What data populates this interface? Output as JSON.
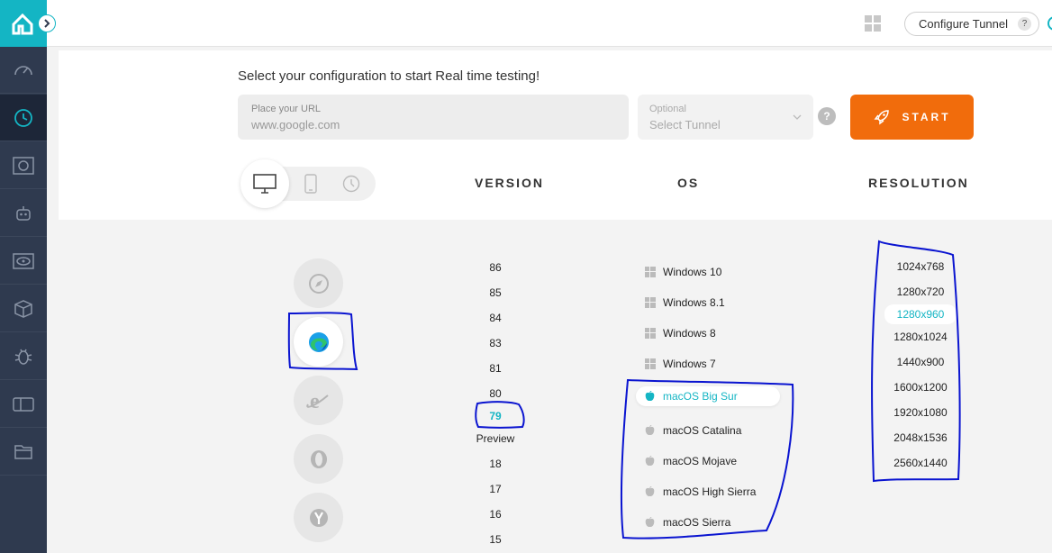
{
  "header": {
    "configure_tunnel": "Configure Tunnel",
    "help": "?"
  },
  "sidebar": {
    "items": [
      "dashboard-icon",
      "realtime-icon",
      "screenshot-icon",
      "automation-icon",
      "visual-icon",
      "app-icon",
      "bug-icon",
      "responsive-icon",
      "files-icon"
    ]
  },
  "config": {
    "headline": "Select your configuration to start Real time testing!",
    "url_label": "Place your URL",
    "url_placeholder": "www.google.com",
    "tunnel_label": "Optional",
    "tunnel_placeholder": "Select Tunnel",
    "help": "?",
    "start_label": "START"
  },
  "columns": {
    "version": "VERSION",
    "os": "OS",
    "resolution": "RESOLUTION"
  },
  "browsers": [
    "safari",
    "edge",
    "ie",
    "opera",
    "yandex"
  ],
  "selected_browser": "edge",
  "versions": [
    "86",
    "85",
    "84",
    "83",
    "81",
    "80",
    "79",
    "Preview",
    "18",
    "17",
    "16",
    "15"
  ],
  "selected_version": "79",
  "os_list": [
    {
      "name": "Windows 10",
      "type": "windows"
    },
    {
      "name": "Windows 8.1",
      "type": "windows"
    },
    {
      "name": "Windows 8",
      "type": "windows"
    },
    {
      "name": "Windows 7",
      "type": "windows"
    },
    {
      "name": "macOS Big Sur",
      "type": "apple"
    },
    {
      "name": "macOS Catalina",
      "type": "apple"
    },
    {
      "name": "macOS Mojave",
      "type": "apple"
    },
    {
      "name": "macOS High Sierra",
      "type": "apple"
    },
    {
      "name": "macOS Sierra",
      "type": "apple"
    }
  ],
  "selected_os": "macOS Big Sur",
  "resolutions": [
    "1024x768",
    "1280x720",
    "1280x960",
    "1280x1024",
    "1440x900",
    "1600x1200",
    "1920x1080",
    "2048x1536",
    "2560x1440"
  ],
  "selected_resolution": "1280x960",
  "colors": {
    "accent": "#14b5c4",
    "start": "#f16c0c",
    "sidebar": "#2f3a4f",
    "annotation": "#0a14d0"
  }
}
